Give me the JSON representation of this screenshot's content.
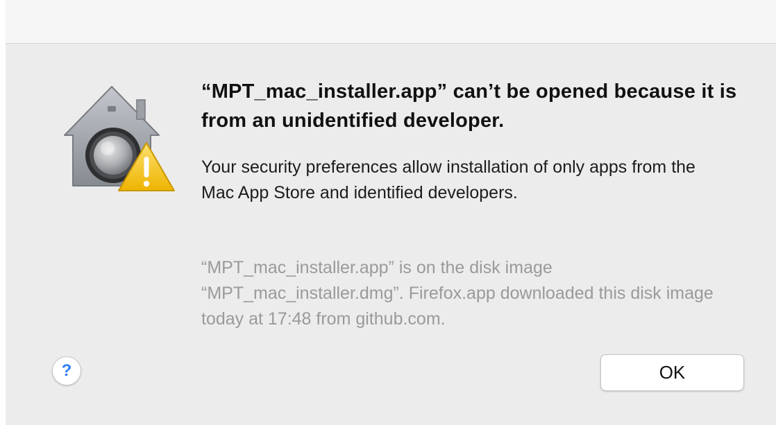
{
  "dialog": {
    "icon": "gatekeeper-security-warning-icon",
    "headline": "“MPT_mac_installer.app” can’t be opened because it is from an unidentified developer.",
    "message": "Your security preferences allow installation of only apps from the Mac App Store and identified developers.",
    "info": "“MPT_mac_installer.app” is on the disk image “MPT_mac_installer.dmg”. Firefox.app downloaded this disk image today at 17:48 from github.com.",
    "help_label": "?",
    "ok_label": "OK"
  },
  "colors": {
    "dialog_background": "#ececec",
    "help_accent": "#2f7cf6",
    "warning_yellow": "#f4c20d",
    "info_text": "#9a9a9a"
  }
}
